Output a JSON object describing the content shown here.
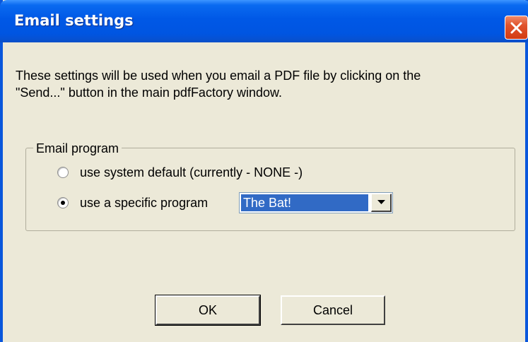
{
  "window": {
    "title": "Email settings"
  },
  "message": {
    "line1": "These settings will be used when you email a PDF file by clicking on the",
    "line2": "\"Send...\" button in the main pdfFactory window."
  },
  "email_program": {
    "group_label": "Email program",
    "options": [
      {
        "label": "use system default (currently - NONE -)",
        "selected": false
      },
      {
        "label": "use a specific program",
        "selected": true
      }
    ],
    "program_select": {
      "value": "The Bat!"
    }
  },
  "buttons": {
    "ok_label": "OK",
    "cancel_label": "Cancel"
  },
  "icons": {
    "close": "close-icon",
    "dropdown": "chevron-down-icon"
  },
  "colors": {
    "titlebar": "#0058e6",
    "close_button": "#e0532c",
    "selection": "#316ac5",
    "dialog_background": "#ece9d8"
  }
}
